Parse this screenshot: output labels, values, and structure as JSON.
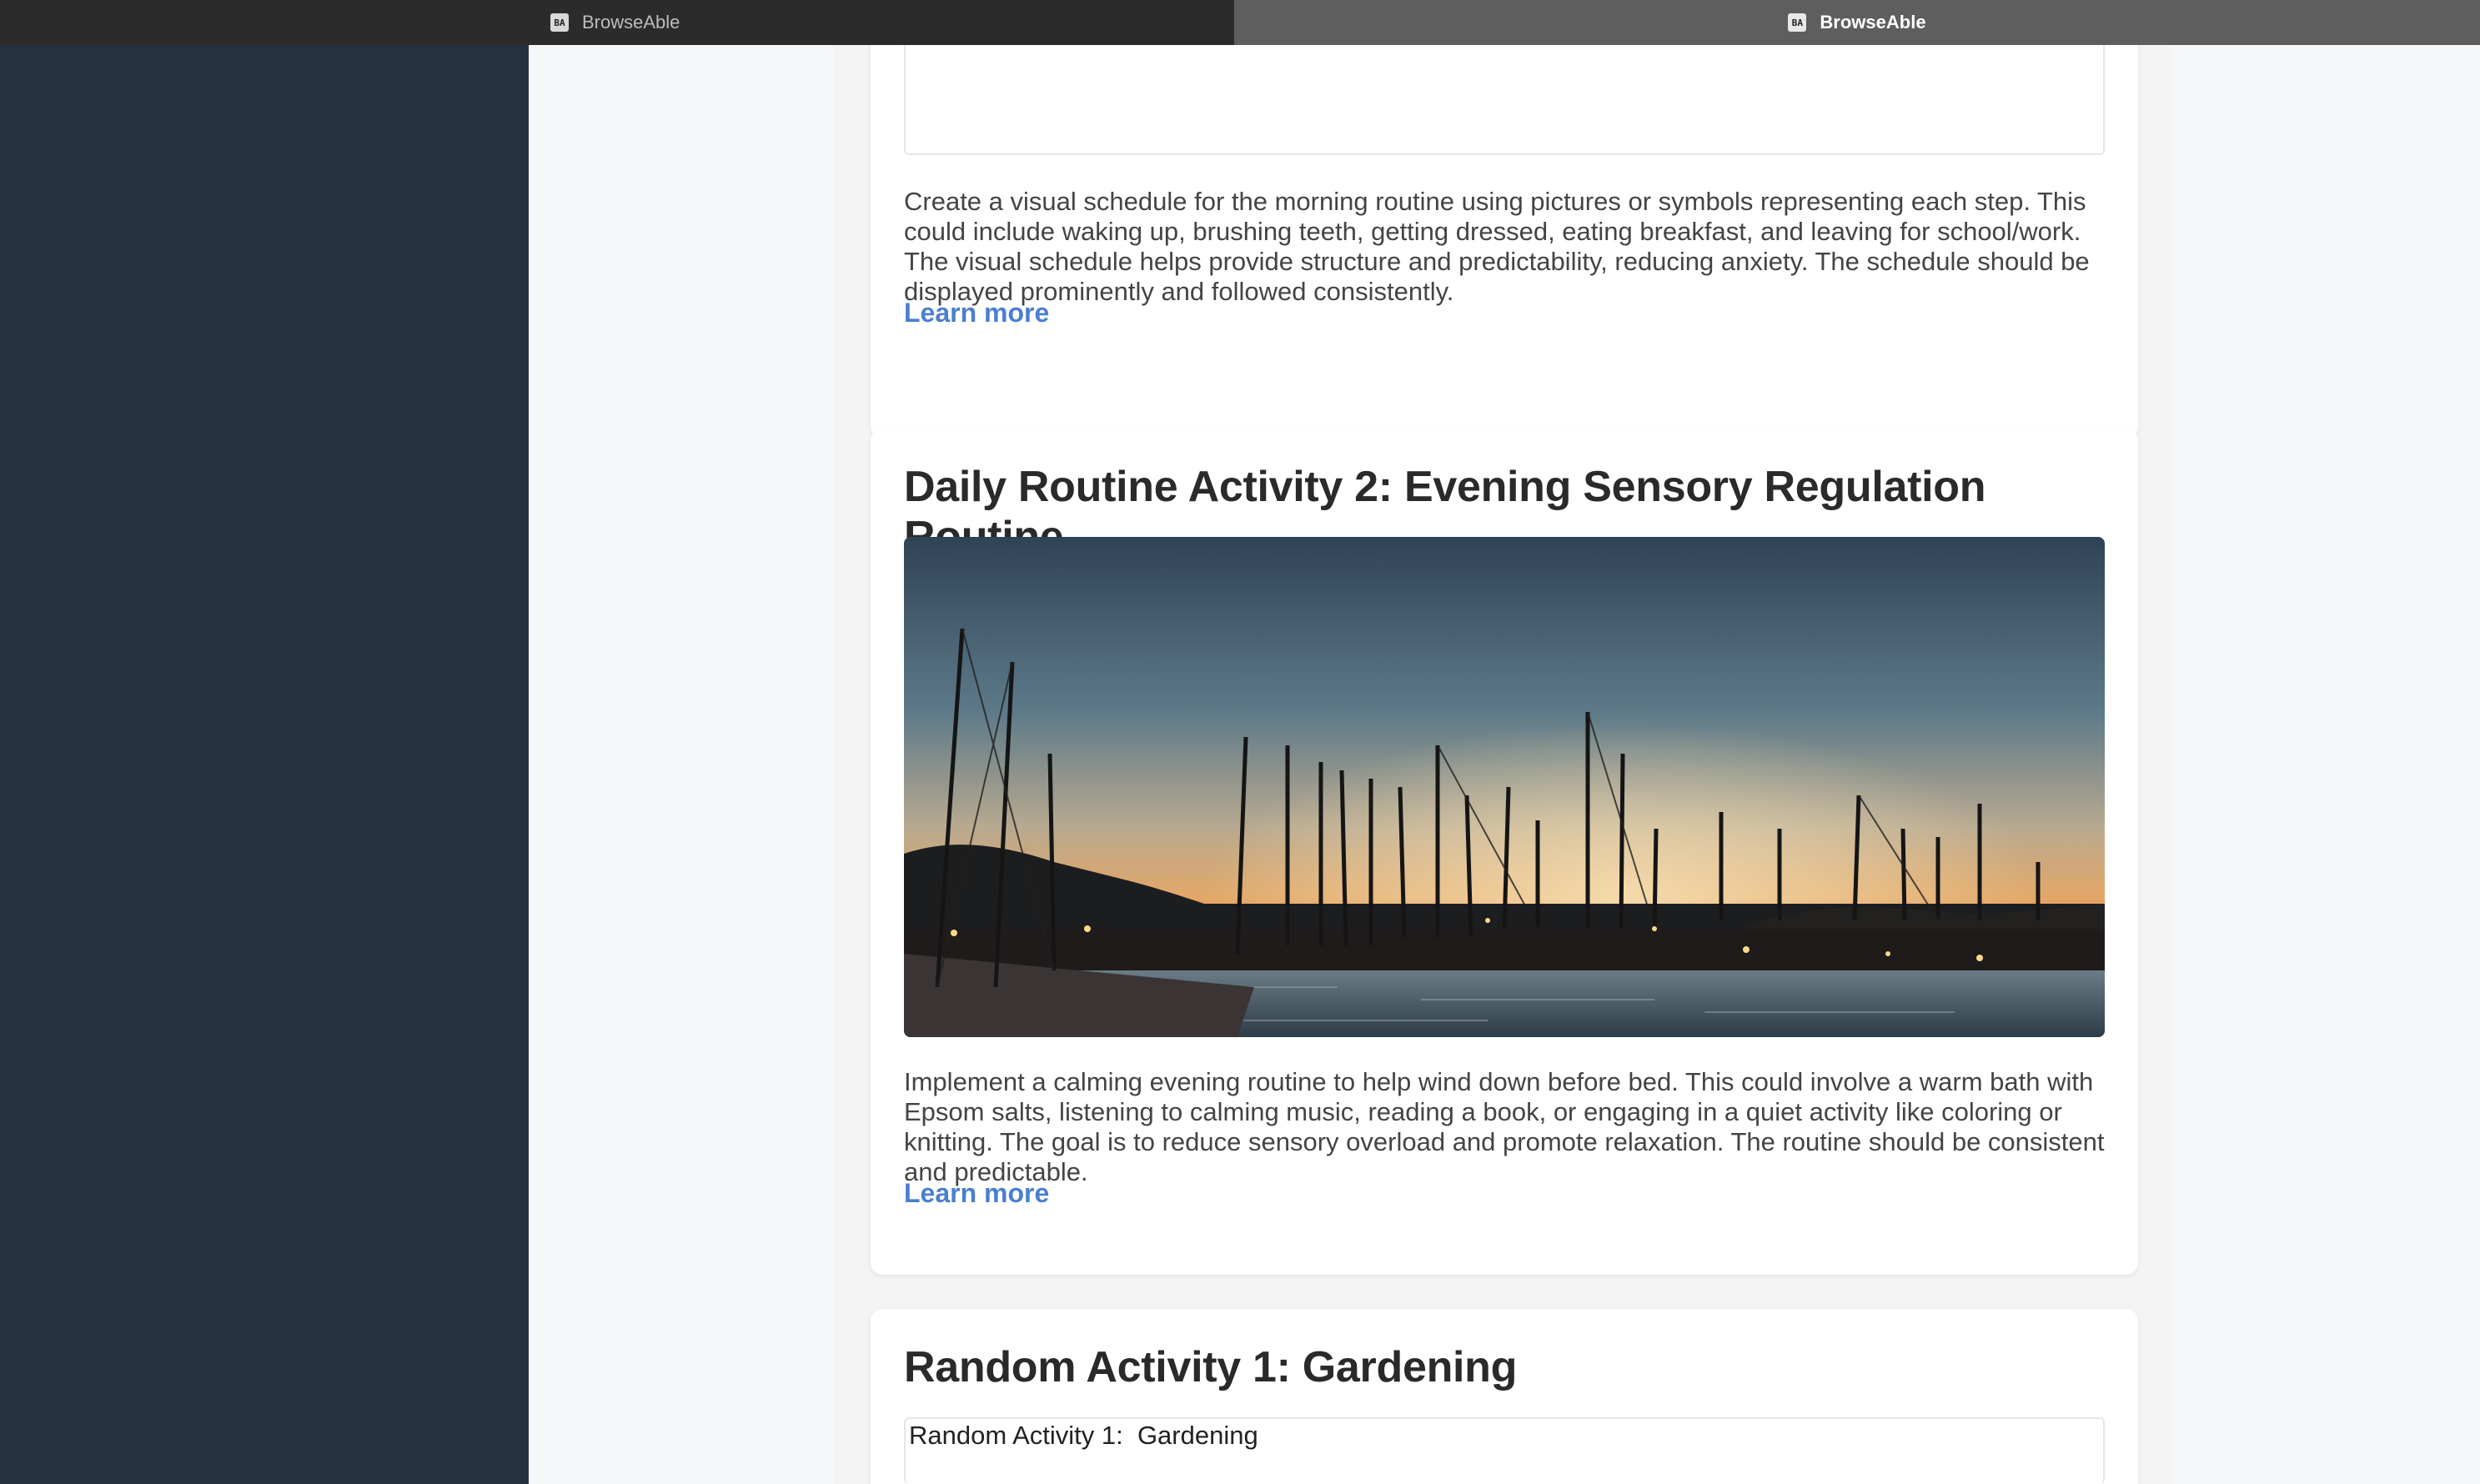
{
  "tabs": [
    {
      "label": "BrowseAble",
      "favicon": "BA",
      "active": false
    },
    {
      "label": "BrowseAble",
      "favicon": "BA",
      "active": true
    }
  ],
  "colors": {
    "sidebar": "#253140",
    "link": "#4a7fd0",
    "heading": "#2a2a2a",
    "body_text": "#444444"
  },
  "cards": {
    "card1": {
      "description": "Create a visual schedule for the morning routine using pictures or symbols representing each step. This could include waking up, brushing teeth, getting dressed, eating breakfast, and leaving for school/work. The visual schedule helps provide structure and predictability, reducing anxiety. The schedule should be displayed prominently and followed consistently.",
      "link_label": "Learn more"
    },
    "card2": {
      "title": "Daily Routine Activity 2: Evening Sensory Regulation Routine",
      "image_icon": "harbor-sunset-photo",
      "description": "Implement a calming evening routine to help wind down before bed. This could involve a warm bath with Epsom salts, listening to calming music, reading a book, or engaging in a quiet activity like coloring or knitting. The goal is to reduce sensory overload and promote relaxation. The routine should be consistent and predictable.",
      "link_label": "Learn more"
    },
    "card3": {
      "title": "Random Activity 1: Gardening",
      "frame_text": "Random Activity 1:  Gardening"
    }
  }
}
